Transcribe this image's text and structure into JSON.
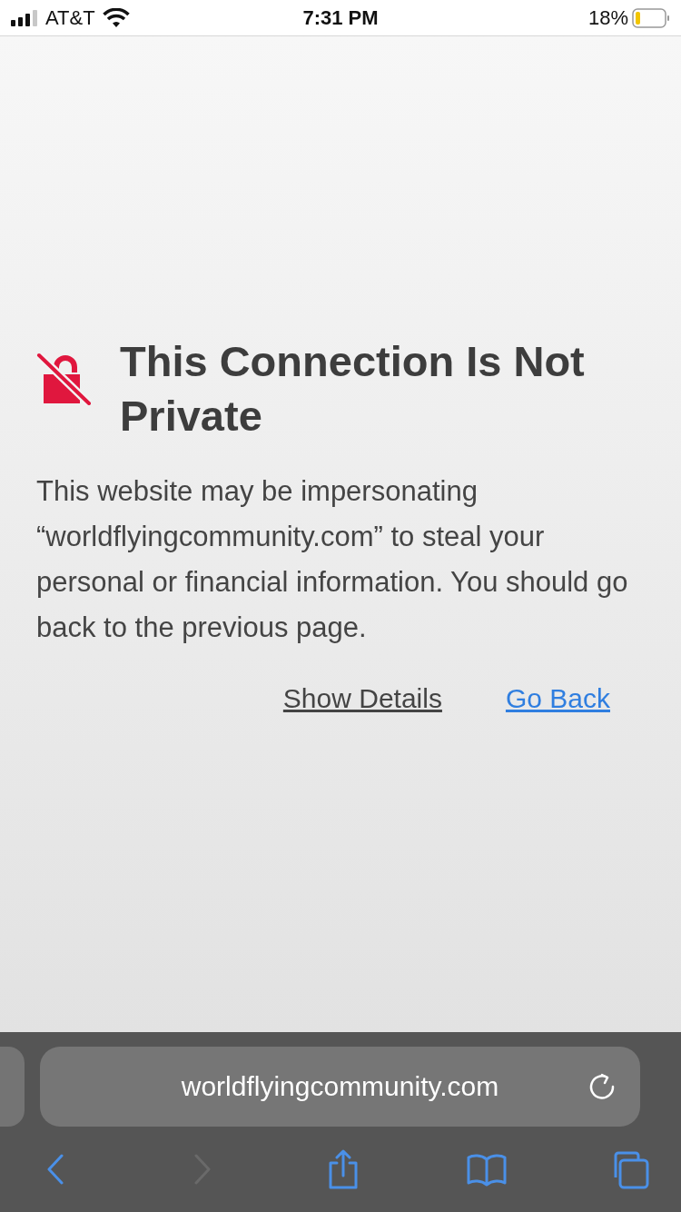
{
  "status_bar": {
    "carrier": "AT&T",
    "time": "7:31 PM",
    "battery": "18%"
  },
  "warning": {
    "title": "This Connection Is Not Private",
    "message": "This website may be impersonating “worldflyingcommunity.com” to steal your personal or financial information. You should go back to the previous page.",
    "links": [
      {
        "label": "Show Details",
        "kind": "plain"
      },
      {
        "label": "Go Back",
        "kind": "primary"
      }
    ]
  },
  "address_bar": {
    "url": "worldflyingcommunity.com"
  },
  "toolbar": [
    {
      "kind": "back",
      "disabled": false
    },
    {
      "kind": "forward",
      "disabled": true
    },
    {
      "kind": "share",
      "disabled": false
    },
    {
      "kind": "bookmarks",
      "disabled": false
    },
    {
      "kind": "tabs",
      "disabled": false
    }
  ]
}
